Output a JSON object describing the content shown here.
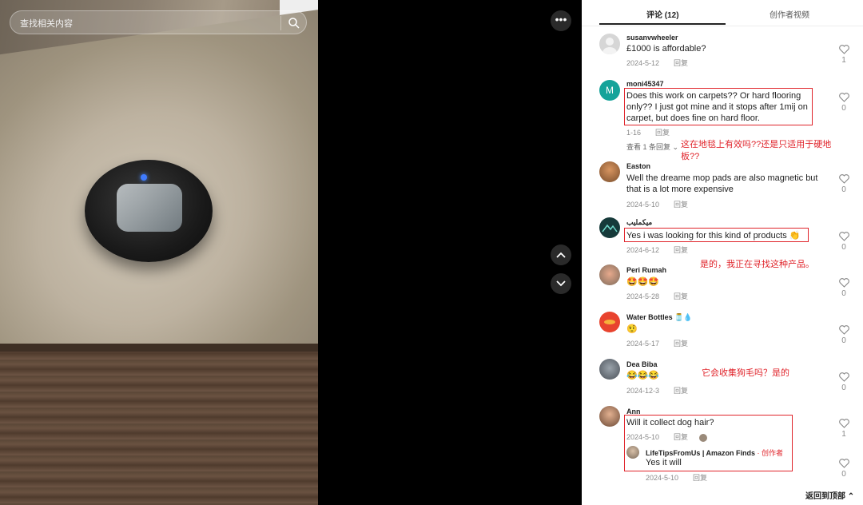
{
  "search": {
    "placeholder": "查找相关内容"
  },
  "tabs": {
    "comments": "评论 (12)",
    "creator_videos": "创作者视频"
  },
  "icons": {
    "search": "search-icon",
    "more": "more-icon",
    "up": "chevron-up-icon",
    "down": "chevron-down-icon",
    "like": "heart-icon"
  },
  "comments": [
    {
      "user": "susanvwheeler",
      "text": "£1000 is affordable?",
      "date": "2024-5-12",
      "reply": "回复",
      "likes": "1"
    },
    {
      "user": "moni45347",
      "avatar_letter": "M",
      "text": "Does this work on carpets?? Or hard flooring only?? I just got mine and it stops after 1mij on carpet, but does fine on hard floor.",
      "date": "1-16",
      "reply": "回复",
      "likes": "0",
      "view_replies": "查看 1 条回复"
    },
    {
      "user": "Easton",
      "text": "Well the dreame mop pads are also magnetic but that is a lot more expensive",
      "date": "2024-5-10",
      "reply": "回复",
      "likes": "0"
    },
    {
      "user": "ميكمليب",
      "text": "Yes i was looking for this kind of products 👏",
      "date": "2024-6-12",
      "reply": "回复",
      "likes": "0"
    },
    {
      "user": "Peri Rumah",
      "text": "🤩🤩🤩",
      "date": "2024-5-28",
      "reply": "回复",
      "likes": "0"
    },
    {
      "user": "Water Bottles 🫙💧",
      "text": "🤨",
      "date": "2024-5-17",
      "reply": "回复",
      "likes": "0"
    },
    {
      "user": "Dea Biba",
      "text": "😂😂😂",
      "date": "2024-12-3",
      "reply": "回复",
      "likes": "0"
    },
    {
      "user": "Ann",
      "text": "Will it collect dog hair?",
      "date": "2024-5-10",
      "reply": "回复",
      "likes": "1"
    }
  ],
  "creator_reply": {
    "user": "LifeTipsFromUs | Amazon Finds",
    "badge": "· 创作者",
    "text": "Yes it will",
    "date": "2024-5-10",
    "reply": "回复",
    "likes": "0"
  },
  "annotations": {
    "a1_line1": "这在地毯上有效吗??还是只适用于硬地",
    "a1_line2": "板??",
    "a2": "是的，我正在寻找这种产品。",
    "a3": "它会收集狗毛吗？是的"
  },
  "back_to_top": "返回到顶部 ⌃"
}
